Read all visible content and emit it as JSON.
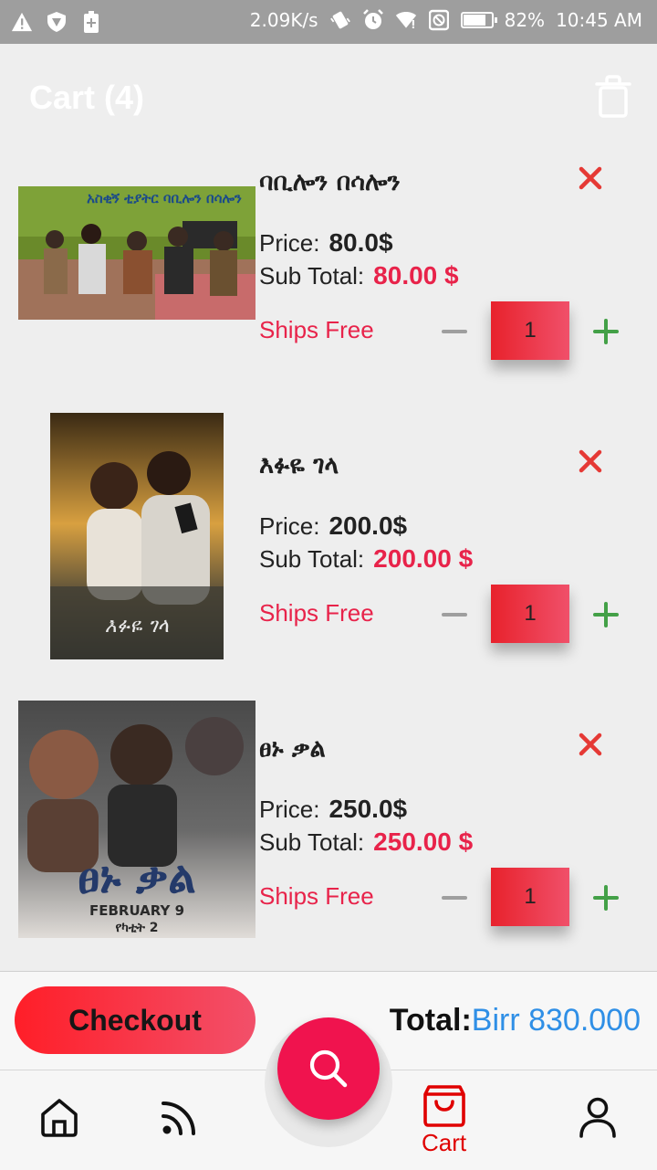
{
  "status_bar": {
    "speed": "2.09K/s",
    "battery": "82%",
    "battery_fraction": 0.82,
    "time": "10:45 AM",
    "icons": [
      "warning-icon",
      "vpn-shield-icon",
      "battery-saver-icon",
      "speed-icon",
      "vibrate-icon",
      "alarm-icon",
      "wifi-icon",
      "dnd-icon",
      "battery-icon"
    ]
  },
  "header": {
    "title": "Cart (4)",
    "trash_icon": "trash-icon"
  },
  "labels": {
    "price": "Price:",
    "sub_total": "Sub Total:",
    "ships": "Ships Free"
  },
  "items": [
    {
      "title": "ባቢሎን በሳሎን",
      "price": "80.0$",
      "subtotal": "80.00 $",
      "qty": "1",
      "poster_text": "አስቂኝ ቲያትር ባቢሎን በሳሎን"
    },
    {
      "title": "እፉዬ ገላ",
      "price": "200.0$",
      "subtotal": "200.00 $",
      "qty": "1",
      "poster_text": "እፉዬ ገላ"
    },
    {
      "title": "ፀኑ ቃል",
      "price": "250.0$",
      "subtotal": "250.00 $",
      "qty": "1",
      "poster_text": "ፀኑ ቃል",
      "poster_date": "FEBRUARY 9",
      "poster_sub": "የካቲት 2"
    }
  ],
  "checkout": {
    "button": "Checkout",
    "total_label": "Total:",
    "total_value": "Birr 830.000"
  },
  "nav": {
    "items": [
      {
        "name": "home",
        "icon": "home-icon",
        "label": ""
      },
      {
        "name": "feed",
        "icon": "rss-icon",
        "label": ""
      },
      {
        "name": "cart",
        "icon": "bag-icon",
        "label": "Cart"
      },
      {
        "name": "profile",
        "icon": "person-icon",
        "label": ""
      }
    ],
    "fab_icon": "search-icon"
  },
  "colors": {
    "accent_red": "#e8234a",
    "qty_red": "#e8222c",
    "plus_green": "#43a047",
    "total_blue": "#2f8fe6",
    "fab": "#f0134e"
  }
}
